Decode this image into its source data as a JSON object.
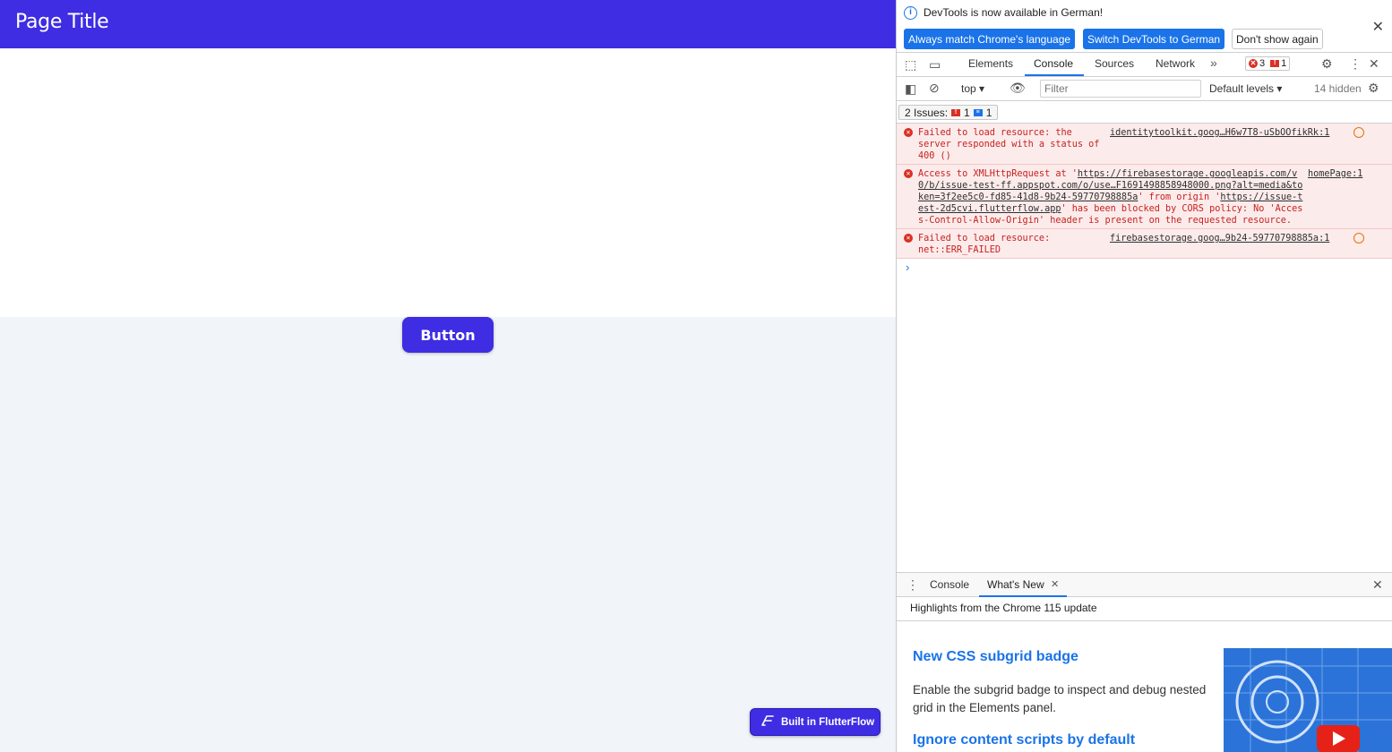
{
  "app": {
    "title": "Page Title",
    "button_label": "Button",
    "badge_label": "Built in FlutterFlow"
  },
  "devtools": {
    "infobar": {
      "message": "DevTools is now available in German!",
      "buttons": [
        "Always match Chrome's language",
        "Switch DevTools to German",
        "Don't show again"
      ]
    },
    "tabs": [
      "Elements",
      "Console",
      "Sources",
      "Network"
    ],
    "active_tab": "Console",
    "error_count": "3",
    "issue_count": "1",
    "toolbar": {
      "context": "top",
      "filter_placeholder": "Filter",
      "levels": "Default levels",
      "hidden": "14 hidden"
    },
    "issues": {
      "label": "2 Issues:",
      "error_count": "1",
      "info_count": "1"
    },
    "messages": [
      {
        "text": "Failed to load resource: the server responded with a status of 400 ()",
        "source": "identitytoolkit.goog…H6w7T8-uSbOOfikRk:1"
      },
      {
        "text_prefix": "Access to XMLHttpRequest at '",
        "url": "https://firebasestorage.googleapis.com/v0/b/issue-test-ff.appspot.com/o/use…F1691498858948000.png?alt=media&token=3f2ee5c0-fd85-41d8-9b24-59770798885a",
        "text_mid": "' from origin '",
        "origin": "https://issue-test-2d5cvi.flutterflow.app",
        "text_suffix": "' has been blocked by CORS policy: No 'Access-Control-Allow-Origin' header is present on the requested resource.",
        "source": "homePage:1"
      },
      {
        "text": "Failed to load resource: net::ERR_FAILED",
        "source": "firebasestorage.goog…9b24-59770798885a:1"
      }
    ],
    "drawer": {
      "tabs": [
        "Console",
        "What's New"
      ],
      "active_tab": "What's New",
      "subheader": "Highlights from the Chrome 115 update",
      "items": [
        {
          "title": "New CSS subgrid badge",
          "body": "Enable the subgrid badge to inspect and debug nested grid in the Elements panel."
        },
        {
          "title": "Ignore content scripts by default",
          "body": ""
        }
      ]
    }
  },
  "colors": {
    "brand": "#3e2de2",
    "devtools_accent": "#1a73e8",
    "error_text": "#c5221f",
    "error_bg": "#fcebeb"
  }
}
